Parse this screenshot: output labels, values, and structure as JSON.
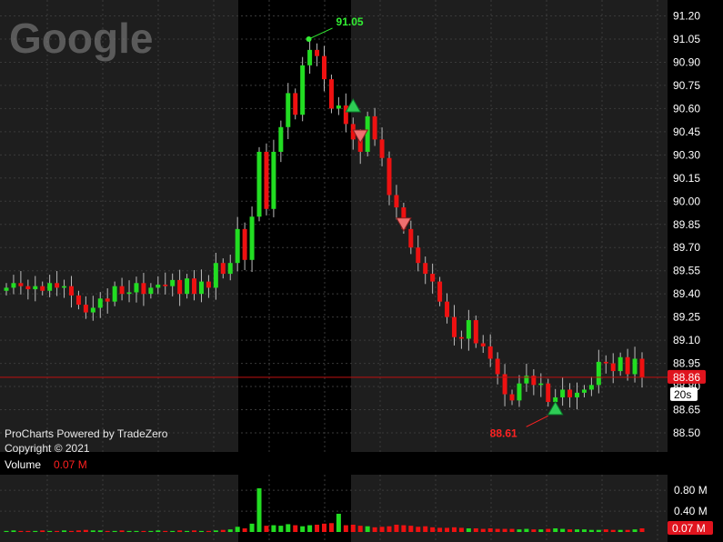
{
  "watermark": "Google",
  "credits": {
    "line1": "ProCharts Powered by TradeZero",
    "line2": "Copyright © 2021"
  },
  "colors": {
    "background": "#000000",
    "panel": "#1e1e1e",
    "session_band": "#000000",
    "up": "#22dd22",
    "down": "#ee1111",
    "grid": "#3a3a3a",
    "price_line": "#c01010",
    "high_marker": "#33ee33",
    "low_marker": "#ff2222"
  },
  "chart_data": {
    "type": "candlestick",
    "price_axis": {
      "ylim": [
        88.47,
        91.26
      ],
      "ticks": [
        "91.20",
        "91.05",
        "90.90",
        "90.75",
        "90.60",
        "90.45",
        "90.30",
        "90.15",
        "90.00",
        "89.85",
        "89.70",
        "89.55",
        "89.40",
        "89.25",
        "89.10",
        "88.95",
        "88.80",
        "88.65",
        "88.50"
      ]
    },
    "current_price": "88.86",
    "timer": "20s",
    "high_marker": {
      "label": "91.05",
      "value": 91.05,
      "bar_index": 43
    },
    "low_marker": {
      "label": "88.61",
      "value": 88.61,
      "bar_index": 76
    },
    "volume_panel": {
      "title": "Volume",
      "value": "0.07 M",
      "ticks": [
        "0.80 M",
        "0.40 M"
      ],
      "current": "0.07 M",
      "ylim": [
        0,
        1.1
      ]
    },
    "signals": [
      {
        "type": "buy",
        "bar_index": 48,
        "value": 90.62
      },
      {
        "type": "sell",
        "bar_index": 49,
        "value": 90.42
      },
      {
        "type": "sell",
        "bar_index": 55,
        "value": 89.85
      },
      {
        "type": "buy",
        "bar_index": 76,
        "value": 88.66
      }
    ],
    "open": [
      89.42,
      89.44,
      89.47,
      89.45,
      89.43,
      89.45,
      89.42,
      89.47,
      89.44,
      89.45,
      89.39,
      89.33,
      89.28,
      89.31,
      89.37,
      89.35,
      89.45,
      89.4,
      89.41,
      89.47,
      89.4,
      89.44,
      89.46,
      89.45,
      89.49,
      89.4,
      89.5,
      89.4,
      89.48,
      89.44,
      89.6,
      89.53,
      89.6,
      89.82,
      89.62,
      89.9,
      90.32,
      89.95,
      90.32,
      90.48,
      90.7,
      90.56,
      90.88,
      90.98,
      90.94,
      90.79,
      90.6,
      90.62,
      90.5,
      90.4,
      90.32,
      90.55,
      90.4,
      90.28,
      90.04,
      89.96,
      89.82,
      89.7,
      89.6,
      89.53,
      89.48,
      89.35,
      89.25,
      89.12,
      89.11,
      89.23,
      89.08,
      89.06,
      88.98,
      88.88,
      88.75,
      88.71,
      88.82,
      88.87,
      88.81,
      88.82,
      88.7,
      88.73,
      88.78,
      88.73,
      88.76,
      88.78,
      88.81,
      88.96,
      88.95,
      88.9,
      88.99,
      88.88,
      88.98
    ],
    "close": [
      89.44,
      89.47,
      89.45,
      89.43,
      89.45,
      89.42,
      89.47,
      89.44,
      89.45,
      89.39,
      89.33,
      89.28,
      89.31,
      89.37,
      89.35,
      89.45,
      89.4,
      89.41,
      89.47,
      89.4,
      89.44,
      89.46,
      89.45,
      89.49,
      89.4,
      89.5,
      89.4,
      89.48,
      89.44,
      89.6,
      89.53,
      89.6,
      89.82,
      89.62,
      89.9,
      90.32,
      89.95,
      90.32,
      90.48,
      90.7,
      90.56,
      90.88,
      90.98,
      90.94,
      90.79,
      90.6,
      90.62,
      90.5,
      90.4,
      90.32,
      90.55,
      90.4,
      90.28,
      90.04,
      89.96,
      89.82,
      89.7,
      89.6,
      89.53,
      89.48,
      89.35,
      89.25,
      89.12,
      89.11,
      89.23,
      89.08,
      89.06,
      88.98,
      88.88,
      88.75,
      88.71,
      88.82,
      88.87,
      88.81,
      88.82,
      88.7,
      88.73,
      88.78,
      88.73,
      88.76,
      88.78,
      88.81,
      88.96,
      88.95,
      88.9,
      88.99,
      88.88,
      88.98,
      88.86
    ],
    "volume": [
      0.02,
      0.03,
      0.02,
      0.02,
      0.02,
      0.03,
      0.02,
      0.02,
      0.03,
      0.02,
      0.03,
      0.04,
      0.03,
      0.03,
      0.02,
      0.02,
      0.03,
      0.02,
      0.02,
      0.02,
      0.02,
      0.03,
      0.02,
      0.02,
      0.03,
      0.02,
      0.03,
      0.02,
      0.02,
      0.03,
      0.04,
      0.05,
      0.1,
      0.07,
      0.16,
      0.84,
      0.12,
      0.13,
      0.12,
      0.15,
      0.13,
      0.11,
      0.13,
      0.14,
      0.16,
      0.17,
      0.35,
      0.13,
      0.14,
      0.12,
      0.11,
      0.09,
      0.1,
      0.11,
      0.14,
      0.13,
      0.12,
      0.1,
      0.11,
      0.09,
      0.08,
      0.08,
      0.09,
      0.08,
      0.07,
      0.07,
      0.06,
      0.07,
      0.06,
      0.06,
      0.06,
      0.05,
      0.06,
      0.05,
      0.05,
      0.06,
      0.07,
      0.06,
      0.05,
      0.05,
      0.05,
      0.04,
      0.04,
      0.05,
      0.04,
      0.04,
      0.04,
      0.05,
      0.07
    ]
  }
}
